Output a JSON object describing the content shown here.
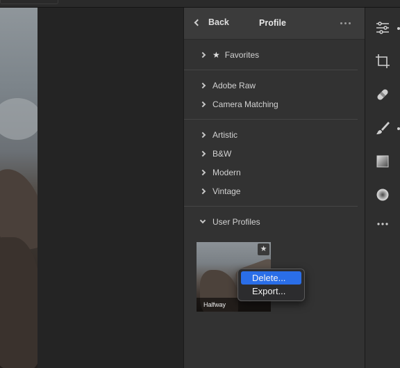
{
  "header": {
    "back_label": "Back",
    "title": "Profile"
  },
  "groups": [
    {
      "items": [
        {
          "label": "Favorites",
          "star": true
        }
      ]
    },
    {
      "items": [
        {
          "label": "Adobe Raw"
        },
        {
          "label": "Camera Matching"
        }
      ]
    },
    {
      "items": [
        {
          "label": "Artistic"
        },
        {
          "label": "B&W"
        },
        {
          "label": "Modern"
        },
        {
          "label": "Vintage"
        }
      ]
    }
  ],
  "user_profiles": {
    "label": "User Profiles",
    "thumbnail": {
      "name": "Halfway",
      "star_icon": "star-icon"
    }
  },
  "context_menu": {
    "items": [
      {
        "label": "Delete...",
        "active": true
      },
      {
        "label": "Export..."
      }
    ]
  },
  "rail_icons": [
    "sliders-icon",
    "crop-icon",
    "healing-icon",
    "brush-icon",
    "gradient-icon",
    "radial-icon",
    "more-icon"
  ],
  "colors": {
    "accent": "#2a6ee8",
    "panel": "#323232",
    "header": "#3b3b3b"
  }
}
